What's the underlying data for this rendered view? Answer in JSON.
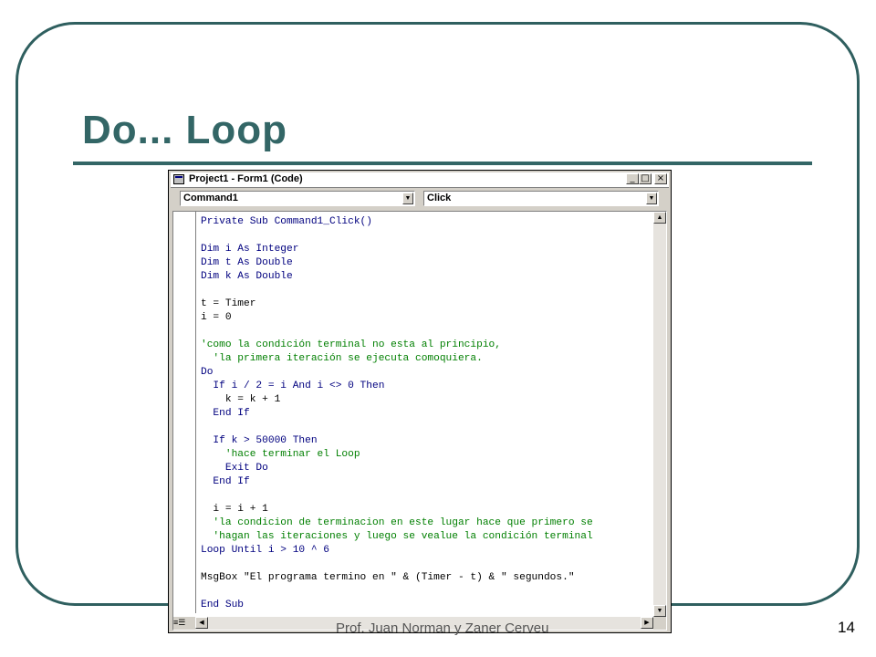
{
  "slide": {
    "title": "Do... Loop",
    "footer": "Prof. Juan Norman y Zaner Cerveu",
    "page_number": "14"
  },
  "window": {
    "title": "Project1 - Form1 (Code)",
    "controls": {
      "minimize": "_",
      "maximize": "□",
      "close": "×"
    },
    "object_combo": "Command1",
    "procedure_combo": "Click"
  },
  "code": [
    {
      "cls": "kw",
      "text": "Private Sub Command1_Click()"
    },
    {
      "cls": "tx",
      "text": ""
    },
    {
      "cls": "kw",
      "text": "Dim i As Integer"
    },
    {
      "cls": "kw",
      "text": "Dim t As Double"
    },
    {
      "cls": "kw",
      "text": "Dim k As Double"
    },
    {
      "cls": "tx",
      "text": ""
    },
    {
      "cls": "tx",
      "text": "t = Timer"
    },
    {
      "cls": "tx",
      "text": "i = 0"
    },
    {
      "cls": "tx",
      "text": ""
    },
    {
      "cls": "cm",
      "text": "'como la condición terminal no esta al principio,"
    },
    {
      "cls": "cm",
      "text": "  'la primera iteración se ejecuta comoquiera."
    },
    {
      "cls": "kw",
      "text": "Do"
    },
    {
      "cls": "kw",
      "text": "  If i / 2 = i And i <> 0 Then"
    },
    {
      "cls": "tx",
      "text": "    k = k + 1"
    },
    {
      "cls": "kw",
      "text": "  End If"
    },
    {
      "cls": "tx",
      "text": ""
    },
    {
      "cls": "kw",
      "text": "  If k > 50000 Then"
    },
    {
      "cls": "cm",
      "text": "    'hace terminar el Loop"
    },
    {
      "cls": "kw",
      "text": "    Exit Do"
    },
    {
      "cls": "kw",
      "text": "  End If"
    },
    {
      "cls": "tx",
      "text": ""
    },
    {
      "cls": "tx",
      "text": "  i = i + 1"
    },
    {
      "cls": "cm",
      "text": "  'la condicion de terminacion en este lugar hace que primero se"
    },
    {
      "cls": "cm",
      "text": "  'hagan las iteraciones y luego se vealue la condición terminal"
    },
    {
      "cls": "kw",
      "text": "Loop Until i > 10 ^ 6"
    },
    {
      "cls": "tx",
      "text": ""
    },
    {
      "cls": "tx",
      "text": "MsgBox \"El programa termino en \" & (Timer - t) & \" segundos.\""
    },
    {
      "cls": "tx",
      "text": ""
    },
    {
      "cls": "kw",
      "text": "End Sub"
    }
  ]
}
